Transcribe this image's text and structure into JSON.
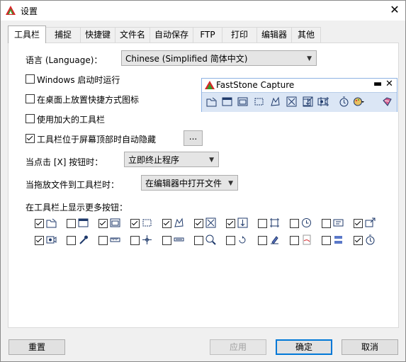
{
  "window": {
    "title": "设置",
    "close_glyph": "✕"
  },
  "tabs": [
    {
      "label": "工具栏",
      "active": true
    },
    {
      "label": "捕捉"
    },
    {
      "label": "快捷键"
    },
    {
      "label": "文件名"
    },
    {
      "label": "自动保存"
    },
    {
      "label": "FTP"
    },
    {
      "label": "打印"
    },
    {
      "label": "编辑器"
    },
    {
      "label": "其他"
    }
  ],
  "language": {
    "label": "语言 (Language)：",
    "value": "Chinese (Simplified 简体中文)"
  },
  "options": [
    {
      "label": "Windows 启动时运行",
      "checked": false
    },
    {
      "label": "在桌面上放置快捷方式图标",
      "checked": false
    },
    {
      "label": "使用加大的工具栏",
      "checked": false
    },
    {
      "label": "工具栏位于屏幕顶部时自动隐藏",
      "checked": true
    }
  ],
  "more_button": "...",
  "close_action": {
    "label": "当点击 [X] 按钮时：",
    "value": "立即终止程序"
  },
  "drop_action": {
    "label": "当拖放文件到工具栏时：",
    "value": "在编辑器中打开文件"
  },
  "more_buttons_label": "在工具栏上显示更多按钮：",
  "icon_buttons_row1": [
    {
      "icon": "open-folder-icon",
      "checked": true
    },
    {
      "icon": "capture-window-icon",
      "checked": false
    },
    {
      "icon": "capture-object-icon",
      "checked": true
    },
    {
      "icon": "capture-rectangle-icon",
      "checked": true
    },
    {
      "icon": "capture-freehand-icon",
      "checked": true
    },
    {
      "icon": "capture-fullscreen-icon",
      "checked": true
    },
    {
      "icon": "capture-scrolling-icon",
      "checked": true
    },
    {
      "icon": "capture-fixed-region-icon",
      "checked": false
    },
    {
      "icon": "delayed-capture-icon",
      "checked": false
    },
    {
      "icon": "text-capture-icon",
      "checked": false
    },
    {
      "icon": "output-icon",
      "checked": true
    }
  ],
  "icon_buttons_row2": [
    {
      "icon": "screen-recorder-icon",
      "checked": true
    },
    {
      "icon": "color-picker-icon",
      "checked": false
    },
    {
      "icon": "screen-ruler-icon",
      "checked": false
    },
    {
      "icon": "crosshair-icon",
      "checked": false
    },
    {
      "icon": "minus-bar-icon",
      "checked": false
    },
    {
      "icon": "magnifier-icon",
      "checked": false
    },
    {
      "icon": "loop-icon",
      "checked": false
    },
    {
      "icon": "screen-pen-icon",
      "checked": false
    },
    {
      "icon": "pdf-icon",
      "checked": false
    },
    {
      "icon": "combine-images-icon",
      "checked": false
    },
    {
      "icon": "timer-icon",
      "checked": true
    }
  ],
  "floating_toolbar": {
    "title": "FastStone Capture",
    "min_glyph": "▬",
    "close_glyph": "✕"
  },
  "footer": {
    "reset": "重置",
    "apply": "应用",
    "ok": "确定",
    "cancel": "取消"
  },
  "colors": {
    "accent": "#0078d7",
    "toolbar_bg": "#dbe6f5",
    "logo_red": "#d8262b",
    "logo_green": "#3a9a2a"
  }
}
